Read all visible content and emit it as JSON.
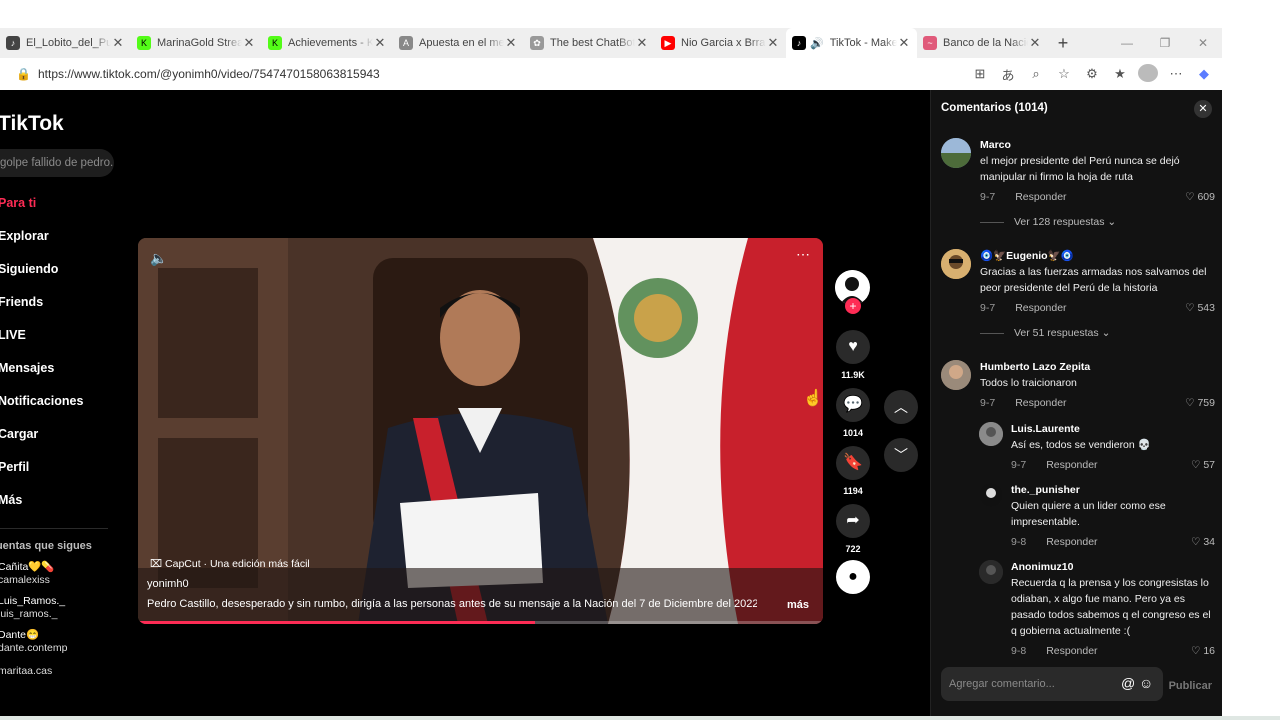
{
  "browser": {
    "tabs": [
      {
        "title": "El_Lobito_del_Pueblo",
        "icon": "tiktok-icon",
        "color": "#444444"
      },
      {
        "title": "MarinaGold Stream",
        "icon": "kick-icon",
        "color": "#53fc18"
      },
      {
        "title": "Achievements - Kick",
        "icon": "kick-icon",
        "color": "#53fc18"
      },
      {
        "title": "Apuesta en el mejor",
        "icon": "site-icon",
        "color": "#888888"
      },
      {
        "title": "The best ChatBot",
        "icon": "chatgpt-icon",
        "color": "#999999"
      },
      {
        "title": "Nio Garcia x Brray",
        "icon": "youtube-icon",
        "color": "#ff0000"
      },
      {
        "title": "TikTok - Make Your Day",
        "icon": "tiktok-icon",
        "color": "#000000"
      },
      {
        "title": "Banco de la Nación",
        "icon": "bank-icon",
        "color": "#e05a7a"
      }
    ],
    "url": "https://www.tiktok.com/@yonimh0/video/7547470158063815943"
  },
  "sidebar": {
    "logo": "TikTok",
    "search_placeholder": "golpe fallido de pedro...",
    "nav": [
      "Para ti",
      "Explorar",
      "Siguiendo",
      "Friends",
      "LIVE",
      "Mensajes",
      "Notificaciones",
      "Cargar",
      "Perfil",
      "Más"
    ],
    "following_title": "Cuentas que sigues",
    "following": [
      {
        "name": "Cañita💛💊",
        "handle": "camalexiss"
      },
      {
        "name": "Luis_Ramos._",
        "handle": "luis_ramos._"
      },
      {
        "name": "Dante😁",
        "handle": "dante.contemp"
      },
      {
        "name": "",
        "handle": "maritaa.cas"
      }
    ]
  },
  "video": {
    "capcut": "CapCut · Una edición más fácil",
    "author": "yonimh0",
    "description": "Pedro Castillo, desesperado y sin rumbo, dirigía a las personas antes de su mensaje a la Nación del 7 de Diciembre del 2022 ...",
    "more": "más",
    "progress": 0.58
  },
  "actions": {
    "likes": "11.9K",
    "comments": "1014",
    "saves": "1194",
    "shares": "722"
  },
  "comments": {
    "title": "Comentarios (1014)",
    "items": [
      {
        "user": "Marco",
        "text": "el mejor presidente del Perú nunca se dejó manipular ni firmo la hoja de ruta",
        "date": "9-7",
        "reply": "Responder",
        "likes": "609",
        "view_replies": "Ver 128 respuestas",
        "avatar": "#6b8aa5"
      },
      {
        "user": "🧿🦅Eugenio🦅🧿",
        "text": "Gracias a las fuerzas armadas nos salvamos del peor presidente del Perú de la historia",
        "date": "9-7",
        "reply": "Responder",
        "likes": "543",
        "view_replies": "Ver 51 respuestas",
        "avatar": "#c59a4a"
      },
      {
        "user": "Humberto Lazo Zepita",
        "text": "Todos lo traicionaron",
        "date": "9-7",
        "reply": "Responder",
        "likes": "759",
        "avatar": "#8a7a6a"
      },
      {
        "user": "Luis.Laurente",
        "text": "Así es, todos se vendieron 💀",
        "date": "9-7",
        "reply": "Responder",
        "likes": "57",
        "avatar": "#777777"
      },
      {
        "user": "the._punisher",
        "text": "Quien quiere a un lider como ese impresentable.",
        "date": "9-8",
        "reply": "Responder",
        "likes": "34",
        "avatar": "#222222"
      },
      {
        "user": "Anonimuz10",
        "text": "Recuerda q la prensa y los congresistas lo odiaban, x algo fue mano. Pero ya es pasado todos sabemos q el congreso es el q gobierna actualmente :(",
        "date": "9-8",
        "reply": "Responder",
        "likes": "16",
        "avatar": "#333333"
      }
    ],
    "input_placeholder": "Agregar comentario...",
    "publish": "Publicar"
  }
}
